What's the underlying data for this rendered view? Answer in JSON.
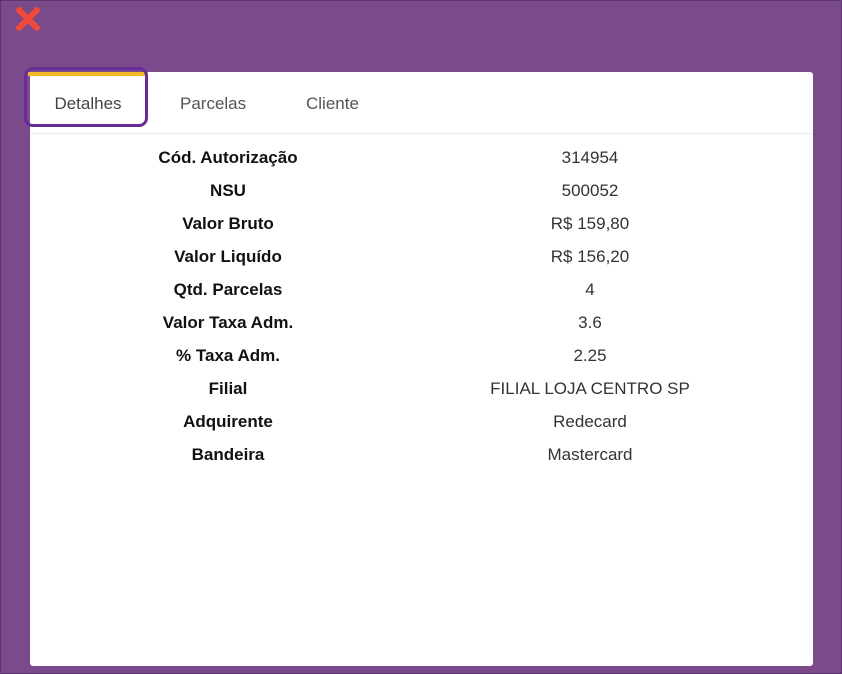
{
  "window": {
    "close_icon_color": "#f04a3a"
  },
  "tabs": [
    {
      "label": "Detalhes",
      "active": true
    },
    {
      "label": "Parcelas",
      "active": false
    },
    {
      "label": "Cliente",
      "active": false
    }
  ],
  "colors": {
    "background": "#7a4a8a",
    "active_tab_bar": "#f3b829",
    "highlight_border": "#6a2b9a"
  },
  "details": [
    {
      "label": "Cód. Autorização",
      "value": "314954"
    },
    {
      "label": "NSU",
      "value": "500052"
    },
    {
      "label": "Valor Bruto",
      "value": "R$ 159,80"
    },
    {
      "label": "Valor Liquído",
      "value": "R$ 156,20"
    },
    {
      "label": "Qtd. Parcelas",
      "value": "4"
    },
    {
      "label": "Valor Taxa Adm.",
      "value": "3.6"
    },
    {
      "label": "% Taxa Adm.",
      "value": "2.25"
    },
    {
      "label": "Filial",
      "value": "FILIAL LOJA CENTRO SP"
    },
    {
      "label": "Adquirente",
      "value": "Redecard"
    },
    {
      "label": "Bandeira",
      "value": "Mastercard"
    }
  ]
}
